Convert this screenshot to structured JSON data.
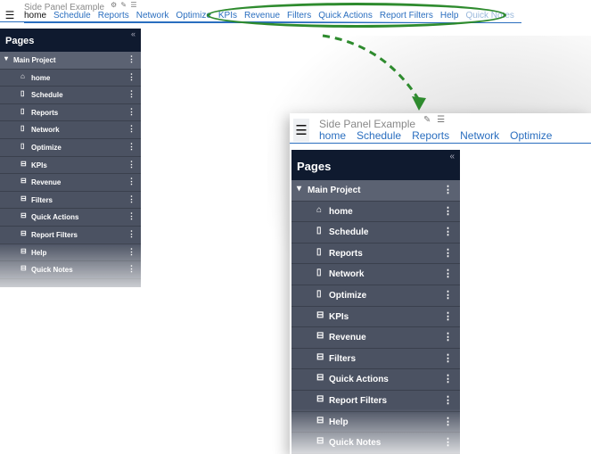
{
  "small": {
    "title": "Side Panel Example",
    "tools": "⚙ ✎ ☰",
    "nav": [
      "home",
      "Schedule",
      "Reports",
      "Network",
      "Optimize",
      "KPIs",
      "Revenue",
      "Filters",
      "Quick Actions",
      "Report Filters",
      "Help",
      "Quick Notes"
    ],
    "panel_title": "Pages",
    "collapse": "«",
    "main_project": "Main Project",
    "items": [
      {
        "label": "home",
        "icon": "house-icon",
        "glyph": "⌂"
      },
      {
        "label": "Schedule",
        "icon": "page-icon",
        "glyph": "▯"
      },
      {
        "label": "Reports",
        "icon": "page-icon",
        "glyph": "▯"
      },
      {
        "label": "Network",
        "icon": "page-icon",
        "glyph": "▯"
      },
      {
        "label": "Optimize",
        "icon": "page-icon",
        "glyph": "▯"
      },
      {
        "label": "KPIs",
        "icon": "panel-icon",
        "glyph": "⊟"
      },
      {
        "label": "Revenue",
        "icon": "panel-icon",
        "glyph": "⊟"
      },
      {
        "label": "Filters",
        "icon": "panel-icon",
        "glyph": "⊟"
      },
      {
        "label": "Quick Actions",
        "icon": "panel-icon",
        "glyph": "⊟"
      },
      {
        "label": "Report Filters",
        "icon": "panel-icon",
        "glyph": "⊟"
      },
      {
        "label": "Help",
        "icon": "panel-icon",
        "glyph": "⊟"
      },
      {
        "label": "Quick Notes",
        "icon": "panel-icon",
        "glyph": "⊟"
      }
    ]
  },
  "big": {
    "title": "Side Panel Example",
    "tools": "✎ ☰",
    "nav": [
      "home",
      "Schedule",
      "Reports",
      "Network",
      "Optimize"
    ],
    "panel_title": "Pages",
    "collapse": "«",
    "main_project": "Main Project"
  },
  "colors": {
    "panel_bg": "#4b5262",
    "panel_header": "#0f1a2f",
    "nav_link": "#2a6ebf",
    "annotation": "#2e8b2e"
  }
}
